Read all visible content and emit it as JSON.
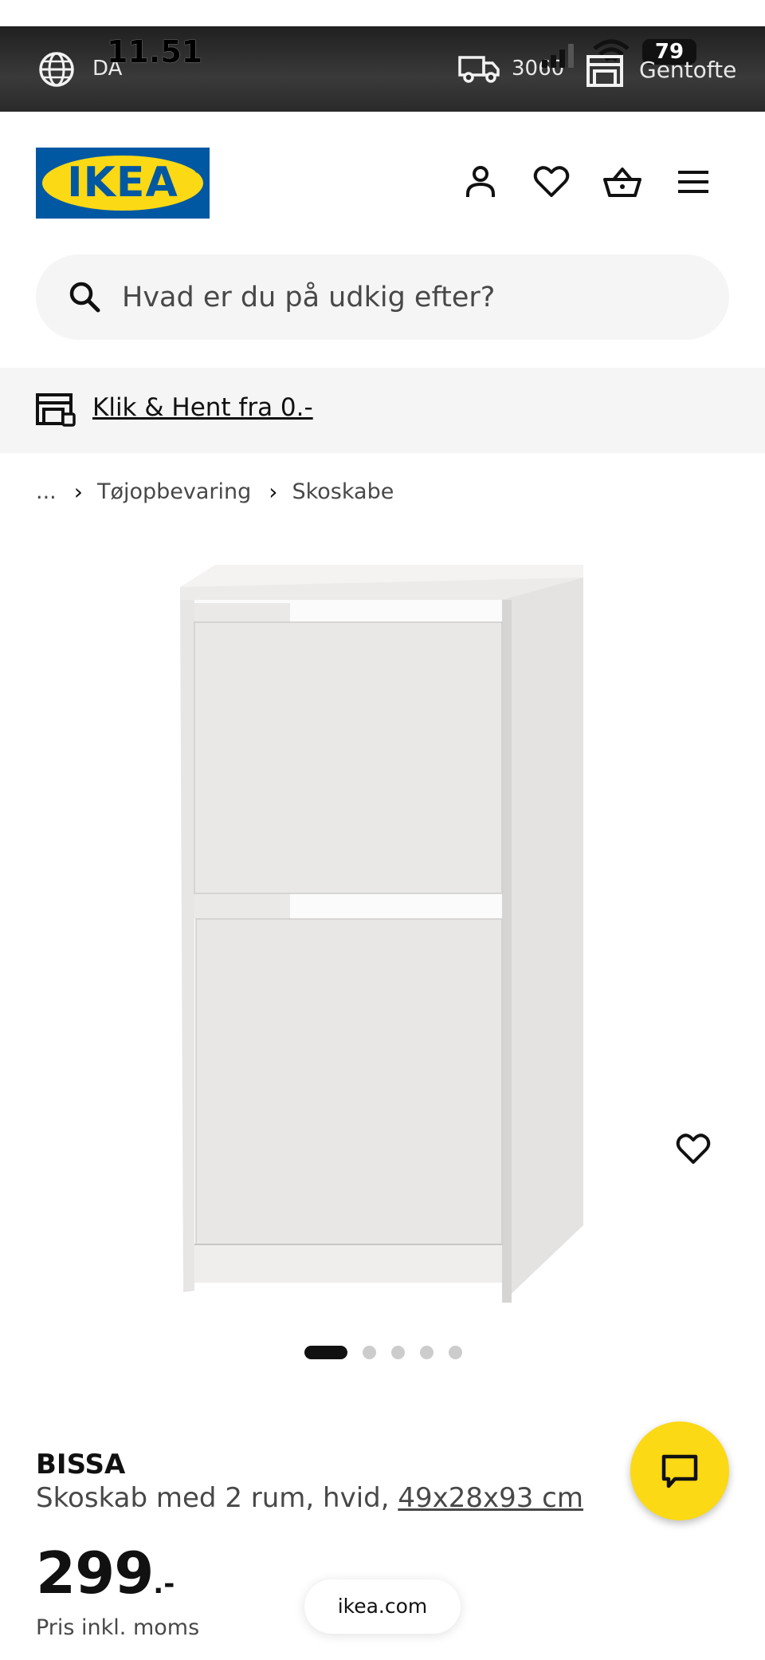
{
  "status_bar": {
    "time": "11.51",
    "battery": "79",
    "language": "DA",
    "postal_code": "3060",
    "store": "Gentofte"
  },
  "header": {
    "logo_text": "IKEA",
    "icons": [
      "user-icon",
      "heart-icon",
      "basket-icon",
      "menu-icon"
    ]
  },
  "search": {
    "placeholder": "Hvad er du på udkig efter?"
  },
  "promo": {
    "label": "Klik & Hent fra 0.-"
  },
  "breadcrumb": {
    "items": [
      "...",
      "Tøjopbevaring",
      "Skoskabe"
    ]
  },
  "gallery": {
    "image_count": 5,
    "active_index": 0
  },
  "product": {
    "name": "BISSA",
    "description": "Skoskab med 2 rum, hvid,",
    "dimensions": "49x28x93 cm",
    "price": "299",
    "price_suffix": ".-",
    "vat_note": "Pris inkl. moms"
  },
  "browser": {
    "url": "ikea.com"
  },
  "colors": {
    "ikea_blue": "#0058a3",
    "ikea_yellow": "#fbd914",
    "text": "#111111",
    "muted": "#484848",
    "panel": "#f5f5f5"
  }
}
